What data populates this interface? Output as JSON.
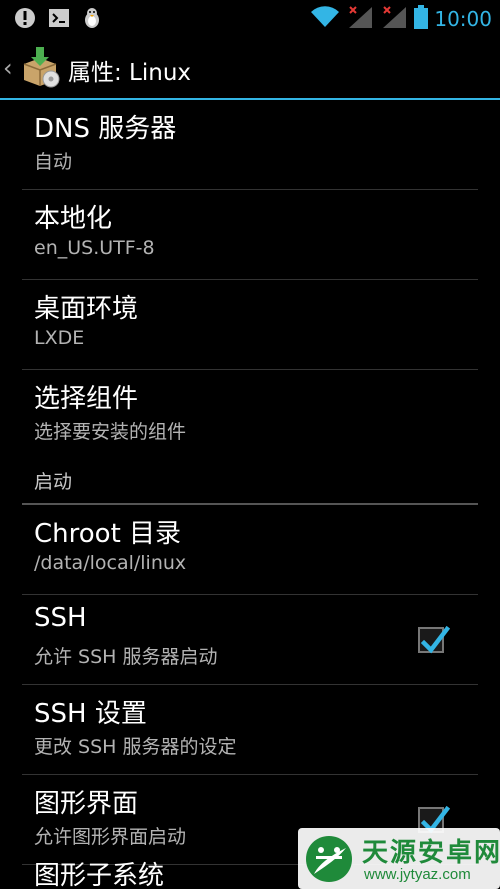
{
  "status_bar": {
    "time": "10:00",
    "icons_left": [
      "alert-icon",
      "terminal-icon",
      "tux-icon"
    ],
    "icons_right": [
      "wifi-icon",
      "signal-icon",
      "signal-icon",
      "battery-icon"
    ],
    "accent_color": "#33b5e5"
  },
  "action_bar": {
    "title": "属性: Linux",
    "back_icon": "chevron-left-icon",
    "app_icon": "install-package-icon"
  },
  "preferences": [
    {
      "title": "DNS 服务器",
      "summary": "自动"
    },
    {
      "title": "本地化",
      "summary": "en_US.UTF-8"
    },
    {
      "title": "桌面环境",
      "summary": "LXDE"
    },
    {
      "title": "选择组件",
      "summary": "选择要安装的组件"
    }
  ],
  "section": {
    "label": "启动"
  },
  "startup_preferences": [
    {
      "title": "Chroot 目录",
      "summary": "/data/local/linux"
    },
    {
      "title": "SSH",
      "summary": "允许 SSH 服务器启动",
      "checked": true
    },
    {
      "title": "SSH 设置",
      "summary": "更改 SSH 服务器的设定"
    },
    {
      "title": "图形界面",
      "summary": "允许图形界面启动",
      "checked": true
    }
  ],
  "partial_item": {
    "title": "图形子系统"
  },
  "watermark": {
    "text_cn": "天源安卓网",
    "text_en": "www.jytyaz.com"
  }
}
